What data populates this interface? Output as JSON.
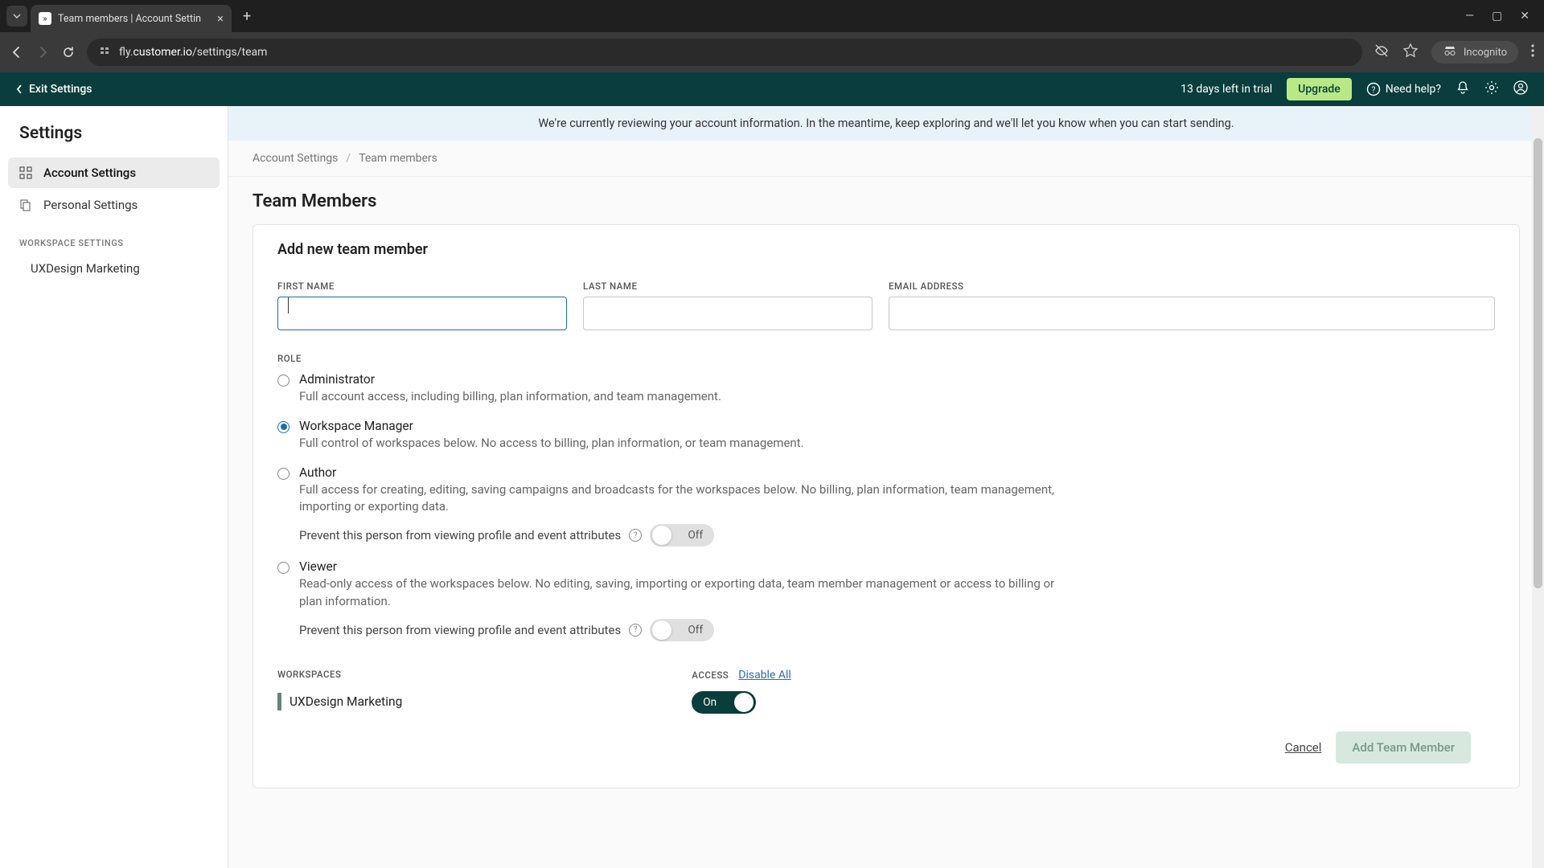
{
  "browser": {
    "tab_title": "Team members | Account Settin",
    "url_prefix": "fly.",
    "url_domain": "customer.io",
    "url_path": "/settings/team",
    "incognito_label": "Incognito"
  },
  "app_bar": {
    "exit_label": "Exit Settings",
    "trial_text": "13 days left in trial",
    "upgrade_label": "Upgrade",
    "help_label": "Need help?"
  },
  "sidebar": {
    "title": "Settings",
    "items": [
      {
        "label": "Account Settings",
        "active": true
      },
      {
        "label": "Personal Settings",
        "active": false
      }
    ],
    "section_label": "WORKSPACE SETTINGS",
    "workspaces": [
      {
        "label": "UXDesign Marketing"
      }
    ]
  },
  "banner": "We're currently reviewing your account information. In the meantime, keep exploring and we'll let you know when you can start sending.",
  "breadcrumb": {
    "root": "Account Settings",
    "current": "Team members"
  },
  "page_title": "Team Members",
  "card": {
    "title": "Add new team member",
    "fields": {
      "first_name_label": "FIRST NAME",
      "last_name_label": "LAST NAME",
      "email_label": "EMAIL ADDRESS"
    },
    "role_label": "ROLE",
    "roles": [
      {
        "name": "Administrator",
        "desc": "Full account access, including billing, plan information, and team management.",
        "checked": false
      },
      {
        "name": "Workspace Manager",
        "desc": "Full control of workspaces below. No access to billing, plan information, or team management.",
        "checked": true
      },
      {
        "name": "Author",
        "desc": "Full access for creating, editing, saving campaigns and broadcasts for the workspaces below. No billing, plan information, team management, importing or exporting data.",
        "checked": false,
        "prevent_text": "Prevent this person from viewing profile and event attributes",
        "toggle": "Off"
      },
      {
        "name": "Viewer",
        "desc": "Read-only access of the workspaces below. No editing, saving, importing or exporting data, team member management or access to billing or plan information.",
        "checked": false,
        "prevent_text": "Prevent this person from viewing profile and event attributes",
        "toggle": "Off"
      }
    ],
    "workspaces_label": "WORKSPACES",
    "access_label": "ACCESS",
    "disable_all_label": "Disable All",
    "workspace_rows": [
      {
        "name": "UXDesign Marketing",
        "toggle": "On"
      }
    ],
    "cancel_label": "Cancel",
    "submit_label": "Add Team Member"
  }
}
